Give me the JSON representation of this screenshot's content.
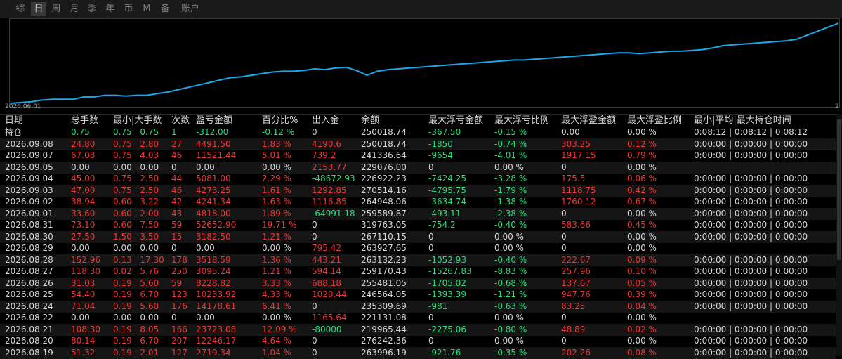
{
  "tabs": [
    {
      "label": "综",
      "active": false
    },
    {
      "label": "日",
      "active": true
    },
    {
      "label": "周",
      "active": false
    },
    {
      "label": "月",
      "active": false
    },
    {
      "label": "季",
      "active": false
    },
    {
      "label": "年",
      "active": false
    },
    {
      "label": "币",
      "active": false
    },
    {
      "label": "M",
      "active": false
    },
    {
      "label": "备",
      "active": false
    },
    {
      "label": "账户",
      "active": false
    }
  ],
  "chart": {
    "x_start_label": "2026.06.01",
    "x_end_label": "2",
    "line_color": "#1aa7e6",
    "values": [
      228000,
      228100,
      228200,
      228400,
      228500,
      228500,
      228500,
      228800,
      228800,
      229000,
      229000,
      228900,
      229000,
      229000,
      229200,
      229400,
      229700,
      230000,
      230300,
      230600,
      230900,
      231200,
      231300,
      231500,
      231700,
      231900,
      232000,
      232000,
      232100,
      232300,
      232200,
      232400,
      232500,
      232100,
      231500,
      232000,
      232200,
      232300,
      232400,
      232500,
      232600,
      232700,
      232800,
      232900,
      233000,
      233100,
      233200,
      233300,
      233400,
      233400,
      233500,
      233600,
      233700,
      233800,
      233900,
      234000,
      234100,
      234200,
      234300,
      234300,
      234200,
      234300,
      234400,
      234500,
      234500,
      234600,
      234700,
      234900,
      235200,
      235300,
      235400,
      235500,
      235600,
      235700,
      235800,
      236000,
      236500,
      237000,
      237500,
      238000
    ]
  },
  "table": {
    "headers": [
      "日期",
      "总手数",
      "最小|大手数",
      "次数",
      "盈亏金额",
      "百分比%",
      "出入金",
      "余额",
      "最大浮亏金额",
      "最大浮亏比例",
      "最大浮盈金额",
      "最大浮盈比例",
      "最小|平均|最大持仓时间"
    ],
    "rows": [
      {
        "c": [
          [
            "持仓",
            "w"
          ],
          [
            "0.75",
            "g"
          ],
          [
            "0.75 | 0.75",
            "g"
          ],
          [
            "1",
            "g"
          ],
          [
            "-312.00",
            "g"
          ],
          [
            "-0.12 %",
            "g"
          ],
          [
            "0",
            "w"
          ],
          [
            "250018.74",
            "w"
          ],
          [
            "-367.50",
            "g"
          ],
          [
            "-0.15 %",
            "g"
          ],
          [
            "0.00",
            "w"
          ],
          [
            "0.00 %",
            "w"
          ],
          [
            "0:08:12 | 0:08:12 | 0:08:12",
            "w"
          ]
        ]
      },
      {
        "c": [
          [
            "2026.09.08",
            "w"
          ],
          [
            "24.80",
            "r"
          ],
          [
            "0.75 | 2.80",
            "r"
          ],
          [
            "27",
            "r"
          ],
          [
            "4491.50",
            "r"
          ],
          [
            "1.83 %",
            "r"
          ],
          [
            "4190.6",
            "r"
          ],
          [
            "250018.74",
            "w"
          ],
          [
            "-1850",
            "g"
          ],
          [
            "-0.74 %",
            "g"
          ],
          [
            "303.25",
            "r"
          ],
          [
            "0.12 %",
            "r"
          ],
          [
            "0:00:00 | 0:00:00 | 0:00:00",
            "w"
          ]
        ]
      },
      {
        "c": [
          [
            "2026.09.07",
            "w"
          ],
          [
            "67.08",
            "r"
          ],
          [
            "0.75 | 4.03",
            "r"
          ],
          [
            "46",
            "r"
          ],
          [
            "11521.44",
            "r"
          ],
          [
            "5.01 %",
            "r"
          ],
          [
            "739.2",
            "r"
          ],
          [
            "241336.64",
            "w"
          ],
          [
            "-9654",
            "g"
          ],
          [
            "-4.01 %",
            "g"
          ],
          [
            "1917.15",
            "r"
          ],
          [
            "0.79 %",
            "r"
          ],
          [
            "0:00:00 | 0:00:00 | 0:00:00",
            "w"
          ]
        ]
      },
      {
        "c": [
          [
            "2026.09.05",
            "w"
          ],
          [
            "0.00",
            "w"
          ],
          [
            "0.00 | 0.00",
            "w"
          ],
          [
            "0",
            "w"
          ],
          [
            "0.00",
            "w"
          ],
          [
            "0.00 %",
            "w"
          ],
          [
            "2153.77",
            "r"
          ],
          [
            "229076.00",
            "w"
          ],
          [
            "0",
            "w"
          ],
          [
            "0.00 %",
            "w"
          ],
          [
            "0",
            "w"
          ],
          [
            "0.00 %",
            "w"
          ],
          [
            "",
            "w"
          ]
        ]
      },
      {
        "c": [
          [
            "2026.09.04",
            "w"
          ],
          [
            "45.00",
            "r"
          ],
          [
            "0.75 | 2.50",
            "r"
          ],
          [
            "44",
            "r"
          ],
          [
            "5081.00",
            "r"
          ],
          [
            "2.29 %",
            "r"
          ],
          [
            "-48672.93",
            "g"
          ],
          [
            "226922.23",
            "w"
          ],
          [
            "-7424.25",
            "g"
          ],
          [
            "-3.28 %",
            "g"
          ],
          [
            "175.5",
            "r"
          ],
          [
            "0.06 %",
            "r"
          ],
          [
            "0:00:00 | 0:00:00 | 0:00:00",
            "w"
          ]
        ]
      },
      {
        "c": [
          [
            "2026.09.03",
            "w"
          ],
          [
            "47.00",
            "r"
          ],
          [
            "0.75 | 2.50",
            "r"
          ],
          [
            "46",
            "r"
          ],
          [
            "4273.25",
            "r"
          ],
          [
            "1.61 %",
            "r"
          ],
          [
            "1292.85",
            "r"
          ],
          [
            "270514.16",
            "w"
          ],
          [
            "-4795.75",
            "g"
          ],
          [
            "-1.79 %",
            "g"
          ],
          [
            "1118.75",
            "r"
          ],
          [
            "0.42 %",
            "r"
          ],
          [
            "0:00:00 | 0:00:00 | 0:00:00",
            "w"
          ]
        ]
      },
      {
        "c": [
          [
            "2026.09.02",
            "w"
          ],
          [
            "38.94",
            "r"
          ],
          [
            "0.60 | 3.22",
            "r"
          ],
          [
            "42",
            "r"
          ],
          [
            "4241.34",
            "r"
          ],
          [
            "1.63 %",
            "r"
          ],
          [
            "1116.85",
            "r"
          ],
          [
            "264948.06",
            "w"
          ],
          [
            "-3634.74",
            "g"
          ],
          [
            "-1.38 %",
            "g"
          ],
          [
            "1760.12",
            "r"
          ],
          [
            "0.67 %",
            "r"
          ],
          [
            "0:00:00 | 0:00:00 | 0:00:00",
            "w"
          ]
        ]
      },
      {
        "c": [
          [
            "2026.09.01",
            "w"
          ],
          [
            "33.60",
            "r"
          ],
          [
            "0.60 | 2.00",
            "r"
          ],
          [
            "43",
            "r"
          ],
          [
            "4818.00",
            "r"
          ],
          [
            "1.89 %",
            "r"
          ],
          [
            "-64991.18",
            "g"
          ],
          [
            "259589.87",
            "w"
          ],
          [
            "-493.11",
            "g"
          ],
          [
            "-2.38 %",
            "g"
          ],
          [
            "0",
            "w"
          ],
          [
            "0.00 %",
            "w"
          ],
          [
            "0:00:00 | 0:00:00 | 0:00:00",
            "w"
          ]
        ]
      },
      {
        "c": [
          [
            "2026.08.31",
            "w"
          ],
          [
            "73.10",
            "r"
          ],
          [
            "0.60 | 7.50",
            "r"
          ],
          [
            "59",
            "r"
          ],
          [
            "52652.90",
            "r"
          ],
          [
            "19.71 %",
            "r"
          ],
          [
            "0",
            "w"
          ],
          [
            "319763.05",
            "w"
          ],
          [
            "-754.2",
            "g"
          ],
          [
            "-0.40 %",
            "g"
          ],
          [
            "583.66",
            "r"
          ],
          [
            "0.45 %",
            "r"
          ],
          [
            "0:00:00 | 0:00:00 | 0:00:00",
            "w"
          ]
        ]
      },
      {
        "c": [
          [
            "2026.08.30",
            "w"
          ],
          [
            "27.50",
            "r"
          ],
          [
            "1.50 | 3.50",
            "r"
          ],
          [
            "15",
            "r"
          ],
          [
            "3182.50",
            "r"
          ],
          [
            "1.21 %",
            "r"
          ],
          [
            "0",
            "w"
          ],
          [
            "267110.15",
            "w"
          ],
          [
            "0",
            "w"
          ],
          [
            "0.00 %",
            "w"
          ],
          [
            "0",
            "w"
          ],
          [
            "0.00 %",
            "w"
          ],
          [
            "0:00:00 | 0:00:00 | 0:00:00",
            "w"
          ]
        ]
      },
      {
        "c": [
          [
            "2026.08.29",
            "w"
          ],
          [
            "0.00",
            "w"
          ],
          [
            "0.00 | 0.00",
            "w"
          ],
          [
            "0",
            "w"
          ],
          [
            "0.00",
            "w"
          ],
          [
            "0.00 %",
            "w"
          ],
          [
            "795.42",
            "r"
          ],
          [
            "263927.65",
            "w"
          ],
          [
            "0",
            "w"
          ],
          [
            "0.00 %",
            "w"
          ],
          [
            "0",
            "w"
          ],
          [
            "0.00 %",
            "w"
          ],
          [
            "",
            "w"
          ]
        ]
      },
      {
        "c": [
          [
            "2026.08.28",
            "w"
          ],
          [
            "152.96",
            "r"
          ],
          [
            "0.13 | 17.30",
            "r"
          ],
          [
            "178",
            "r"
          ],
          [
            "3518.59",
            "r"
          ],
          [
            "1.36 %",
            "r"
          ],
          [
            "443.21",
            "r"
          ],
          [
            "263132.23",
            "w"
          ],
          [
            "-1052.93",
            "g"
          ],
          [
            "-0.40 %",
            "g"
          ],
          [
            "222.67",
            "r"
          ],
          [
            "0.09 %",
            "r"
          ],
          [
            "0:00:00 | 0:00:00 | 0:00:00",
            "w"
          ]
        ]
      },
      {
        "c": [
          [
            "2026.08.27",
            "w"
          ],
          [
            "118.30",
            "r"
          ],
          [
            "0.02 | 5.76",
            "r"
          ],
          [
            "250",
            "r"
          ],
          [
            "3095.24",
            "r"
          ],
          [
            "1.21 %",
            "r"
          ],
          [
            "594.14",
            "r"
          ],
          [
            "259170.43",
            "w"
          ],
          [
            "-15267.83",
            "g"
          ],
          [
            "-8.83 %",
            "g"
          ],
          [
            "257.96",
            "r"
          ],
          [
            "0.10 %",
            "r"
          ],
          [
            "0:00:00 | 0:00:00 | 0:00:00",
            "w"
          ]
        ]
      },
      {
        "c": [
          [
            "2026.08.26",
            "w"
          ],
          [
            "31.03",
            "r"
          ],
          [
            "0.19 | 5.60",
            "r"
          ],
          [
            "59",
            "r"
          ],
          [
            "8228.82",
            "r"
          ],
          [
            "3.33 %",
            "r"
          ],
          [
            "688.18",
            "r"
          ],
          [
            "255481.05",
            "w"
          ],
          [
            "-1705.02",
            "g"
          ],
          [
            "-0.68 %",
            "g"
          ],
          [
            "137.67",
            "r"
          ],
          [
            "0.05 %",
            "r"
          ],
          [
            "0:00:00 | 0:00:00 | 0:00:00",
            "w"
          ]
        ]
      },
      {
        "c": [
          [
            "2026.08.25",
            "w"
          ],
          [
            "54.40",
            "r"
          ],
          [
            "0.19 | 6.70",
            "r"
          ],
          [
            "123",
            "r"
          ],
          [
            "10233.92",
            "r"
          ],
          [
            "4.33 %",
            "r"
          ],
          [
            "1020.44",
            "r"
          ],
          [
            "246564.05",
            "w"
          ],
          [
            "-1393.39",
            "g"
          ],
          [
            "-1.21 %",
            "g"
          ],
          [
            "947.76",
            "r"
          ],
          [
            "0.39 %",
            "r"
          ],
          [
            "0:00:00 | 0:00:00 | 0:00:00",
            "w"
          ]
        ]
      },
      {
        "c": [
          [
            "2026.08.24",
            "w"
          ],
          [
            "71.04",
            "r"
          ],
          [
            "0.19 | 5.60",
            "r"
          ],
          [
            "176",
            "r"
          ],
          [
            "14178.61",
            "r"
          ],
          [
            "6.41 %",
            "r"
          ],
          [
            "0",
            "w"
          ],
          [
            "235309.69",
            "w"
          ],
          [
            "-981",
            "g"
          ],
          [
            "-0.63 %",
            "g"
          ],
          [
            "83.25",
            "r"
          ],
          [
            "0.04 %",
            "r"
          ],
          [
            "0:00:00 | 0:00:00 | 0:00:00",
            "w"
          ]
        ]
      },
      {
        "c": [
          [
            "2026.08.22",
            "w"
          ],
          [
            "0.00",
            "w"
          ],
          [
            "0.00 | 0.00",
            "w"
          ],
          [
            "0",
            "w"
          ],
          [
            "0.00",
            "w"
          ],
          [
            "0.00 %",
            "w"
          ],
          [
            "1165.64",
            "r"
          ],
          [
            "221131.08",
            "w"
          ],
          [
            "0",
            "w"
          ],
          [
            "0.00 %",
            "w"
          ],
          [
            "0",
            "w"
          ],
          [
            "0.00 %",
            "w"
          ],
          [
            "",
            "w"
          ]
        ]
      },
      {
        "c": [
          [
            "2026.08.21",
            "w"
          ],
          [
            "108.30",
            "r"
          ],
          [
            "0.19 | 8.05",
            "r"
          ],
          [
            "166",
            "r"
          ],
          [
            "23723.08",
            "r"
          ],
          [
            "12.09 %",
            "r"
          ],
          [
            "-80000",
            "g"
          ],
          [
            "219965.44",
            "w"
          ],
          [
            "-2275.06",
            "g"
          ],
          [
            "-0.80 %",
            "g"
          ],
          [
            "48.89",
            "r"
          ],
          [
            "0.02 %",
            "r"
          ],
          [
            "0:00:00 | 0:00:00 | 0:00:00",
            "w"
          ]
        ]
      },
      {
        "c": [
          [
            "2026.08.20",
            "w"
          ],
          [
            "80.14",
            "r"
          ],
          [
            "0.19 | 6.70",
            "r"
          ],
          [
            "207",
            "r"
          ],
          [
            "12246.17",
            "r"
          ],
          [
            "4.64 %",
            "r"
          ],
          [
            "0",
            "w"
          ],
          [
            "276242.36",
            "w"
          ],
          [
            "0",
            "w"
          ],
          [
            "0.00 %",
            "w"
          ],
          [
            "0",
            "w"
          ],
          [
            "0.00 %",
            "w"
          ],
          [
            "0:00:00 | 0:00:00 | 0:00:00",
            "w"
          ]
        ]
      },
      {
        "c": [
          [
            "2026.08.19",
            "w"
          ],
          [
            "51.32",
            "r"
          ],
          [
            "0.19 | 2.01",
            "r"
          ],
          [
            "127",
            "r"
          ],
          [
            "2719.34",
            "r"
          ],
          [
            "1.04 %",
            "r"
          ],
          [
            "0",
            "w"
          ],
          [
            "263996.19",
            "w"
          ],
          [
            "-921.76",
            "g"
          ],
          [
            "-0.35 %",
            "g"
          ],
          [
            "202.26",
            "r"
          ],
          [
            "0.08 %",
            "r"
          ],
          [
            "0:00:00 | 0:00:00 | 0:00:00",
            "w"
          ]
        ]
      }
    ]
  }
}
